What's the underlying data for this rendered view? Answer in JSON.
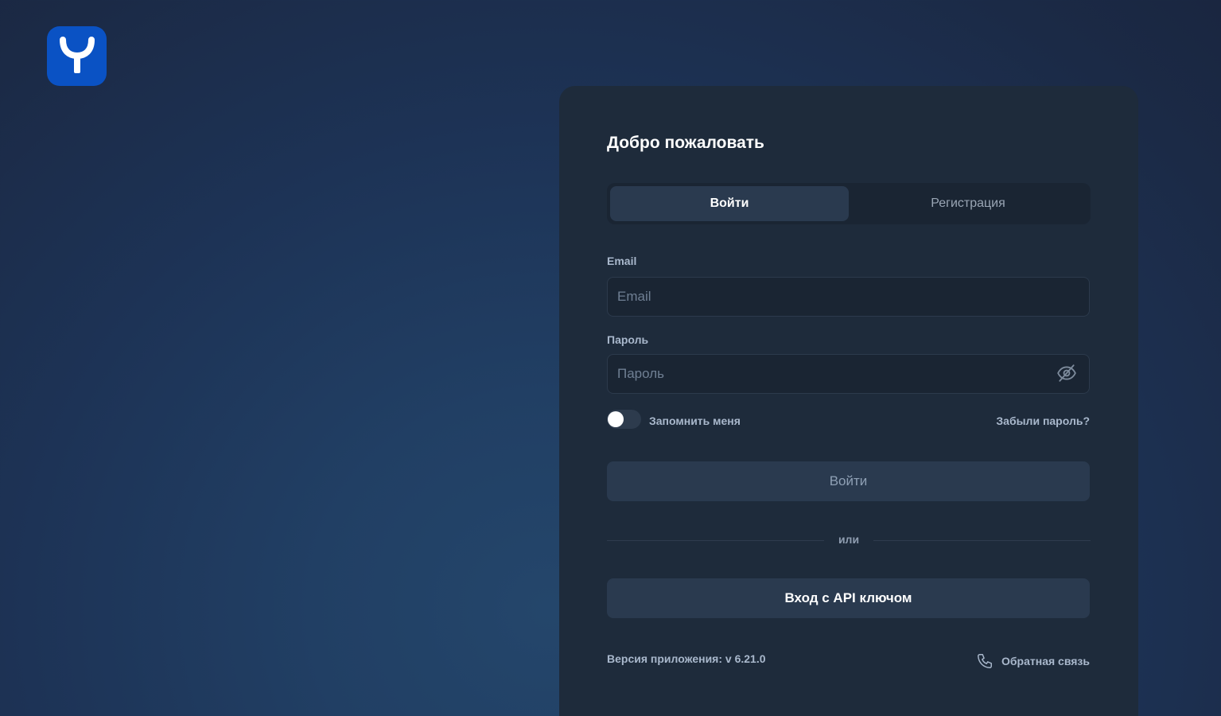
{
  "logo": {
    "icon": "y-logo-icon",
    "color": "#0a52c4"
  },
  "card": {
    "title": "Добро пожаловать",
    "tabs": [
      {
        "label": "Войти",
        "active": true
      },
      {
        "label": "Регистрация",
        "active": false
      }
    ],
    "email": {
      "label": "Email",
      "placeholder": "Email",
      "value": ""
    },
    "password": {
      "label": "Пароль",
      "placeholder": "Пароль",
      "value": "",
      "icon": "eye-off-icon"
    },
    "remember": {
      "label": "Запомнить меня",
      "checked": false
    },
    "forgot_link": "Забыли пароль?",
    "login_button": "Войти",
    "divider_text": "или",
    "api_button": "Вход с API ключом",
    "version": "Версия приложения: v 6.21.0",
    "feedback": {
      "label": "Обратная связь",
      "icon": "phone-icon"
    }
  }
}
